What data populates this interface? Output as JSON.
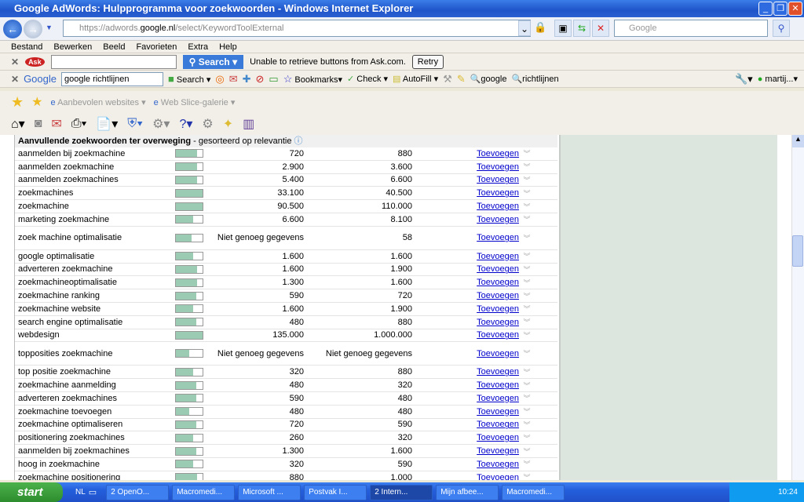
{
  "window": {
    "title": "Google AdWords: Hulpprogramma voor zoekwoorden - Windows Internet Explorer"
  },
  "address": {
    "scheme": "https://",
    "host_pre": "adwords.",
    "host": "google.nl",
    "path": "/select/KeywordToolExternal",
    "search_placeholder": "Google"
  },
  "menu": [
    "Bestand",
    "Bewerken",
    "Beeld",
    "Favorieten",
    "Extra",
    "Help"
  ],
  "ask_toolbar": {
    "search_label": "Search",
    "message": "Unable to retrieve buttons from Ask.com.",
    "retry_label": "Retry"
  },
  "google_toolbar": {
    "logo": "Google",
    "query": "google richtlijnen",
    "search_label": "Search",
    "bookmarks_label": "Bookmarks",
    "check_label": "Check",
    "autofill_label": "AutoFill",
    "highlight1": "google",
    "highlight2": "richtlijnen",
    "account": "martij..."
  },
  "favorites_bar": {
    "item1": "Aanbevolen websites",
    "item2": "Web Slice-galerie"
  },
  "table": {
    "title": "Aanvullende zoekwoorden ter overweging",
    "subtitle": " - gesorteerd op relevantie",
    "add_label": "Toevoegen",
    "bar_color": "#9ccbb3",
    "rows": [
      {
        "keyword": "aanmelden bij zoekmachine",
        "level": 0.8,
        "v1": "720",
        "v2": "880"
      },
      {
        "keyword": "aanmelden zoekmachine",
        "level": 0.8,
        "v1": "2.900",
        "v2": "3.600"
      },
      {
        "keyword": "aanmelden zoekmachines",
        "level": 0.8,
        "v1": "5.400",
        "v2": "6.600"
      },
      {
        "keyword": "zoekmachines",
        "level": 1.0,
        "v1": "33.100",
        "v2": "40.500"
      },
      {
        "keyword": "zoekmachine",
        "level": 1.0,
        "v1": "90.500",
        "v2": "110.000"
      },
      {
        "keyword": "marketing zoekmachine",
        "level": 0.65,
        "v1": "6.600",
        "v2": "8.100"
      },
      {
        "keyword": "zoek machine optimalisatie",
        "level": 0.6,
        "v1": "Niet genoeg gegevens",
        "v2": "58"
      },
      {
        "keyword": "google optimalisatie",
        "level": 0.65,
        "v1": "1.600",
        "v2": "1.600"
      },
      {
        "keyword": "adverteren zoekmachine",
        "level": 0.8,
        "v1": "1.600",
        "v2": "1.900"
      },
      {
        "keyword": "zoekmachineoptimalisatie",
        "level": 0.8,
        "v1": "1.300",
        "v2": "1.600"
      },
      {
        "keyword": "zoekmachine ranking",
        "level": 0.75,
        "v1": "590",
        "v2": "720"
      },
      {
        "keyword": "zoekmachine website",
        "level": 0.65,
        "v1": "1.600",
        "v2": "1.900"
      },
      {
        "keyword": "search engine optimalisatie",
        "level": 0.75,
        "v1": "480",
        "v2": "880"
      },
      {
        "keyword": "webdesign",
        "level": 1.0,
        "v1": "135.000",
        "v2": "1.000.000"
      },
      {
        "keyword": "topposities zoekmachine",
        "level": 0.5,
        "v1": "Niet genoeg gegevens",
        "v2": "Niet genoeg gegevens"
      },
      {
        "keyword": "top positie zoekmachine",
        "level": 0.65,
        "v1": "320",
        "v2": "880"
      },
      {
        "keyword": "zoekmachine aanmelding",
        "level": 0.75,
        "v1": "480",
        "v2": "320"
      },
      {
        "keyword": "adverteren zoekmachines",
        "level": 0.75,
        "v1": "590",
        "v2": "480"
      },
      {
        "keyword": "zoekmachine toevoegen",
        "level": 0.5,
        "v1": "480",
        "v2": "480"
      },
      {
        "keyword": "zoekmachine optimaliseren",
        "level": 0.75,
        "v1": "720",
        "v2": "590"
      },
      {
        "keyword": "positionering zoekmachines",
        "level": 0.65,
        "v1": "260",
        "v2": "320"
      },
      {
        "keyword": "aanmelden bij zoekmachines",
        "level": 0.75,
        "v1": "1.300",
        "v2": "1.600"
      },
      {
        "keyword": "hoog in zoekmachine",
        "level": 0.65,
        "v1": "320",
        "v2": "590"
      },
      {
        "keyword": "zoekmachine positionering",
        "level": 0.8,
        "v1": "880",
        "v2": "1.000"
      }
    ]
  },
  "taskbar": {
    "start": "start",
    "lang": "NL",
    "items": [
      "2 OpenO...",
      "Macromedi...",
      "Microsoft ...",
      "Postvak I...",
      "2 Intern...",
      "Mijn afbee...",
      "Macromedi..."
    ],
    "active_index": 4,
    "clock": "10:24"
  }
}
